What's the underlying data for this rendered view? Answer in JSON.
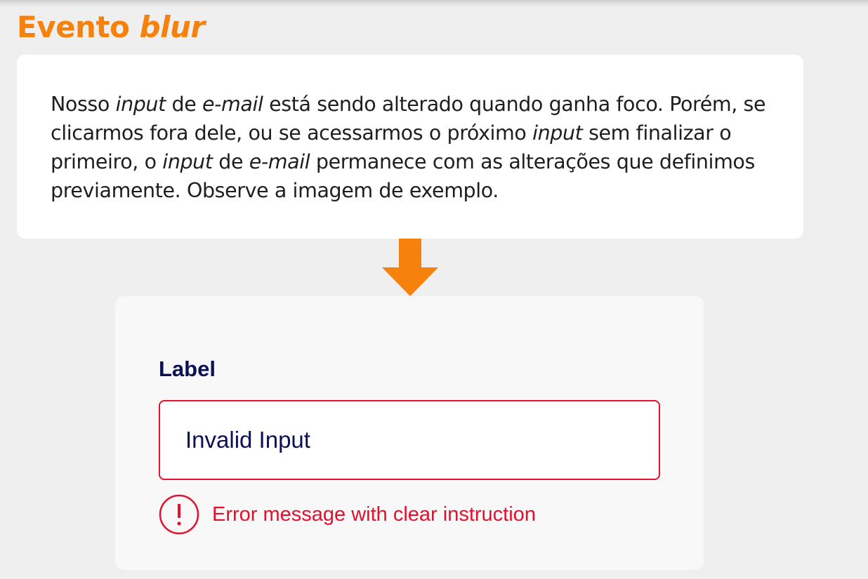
{
  "title": {
    "main": "Evento",
    "emphasis": "blur"
  },
  "description": {
    "s1": "Nosso ",
    "s2": "input",
    "s3": " de ",
    "s4": "e-mail",
    "s5": " está sendo alterado quando ganha foco. Porém, se clicarmos fora dele, ou se acessarmos o próximo ",
    "s6": "input",
    "s7": " sem finalizar o primeiro, o ",
    "s8": "input",
    "s9": " de ",
    "s10": "e-mail",
    "s11": " permanece com as alterações que definimos previamente. Observe a imagem de exemplo."
  },
  "example": {
    "label": "Label",
    "input_value": "Invalid Input",
    "error_icon": "alert-circle-icon",
    "error_message": "Error message with clear instruction"
  },
  "colors": {
    "accent": "#f6820d",
    "error": "#e3102e",
    "navy": "#0b1154",
    "background": "#efefef"
  }
}
